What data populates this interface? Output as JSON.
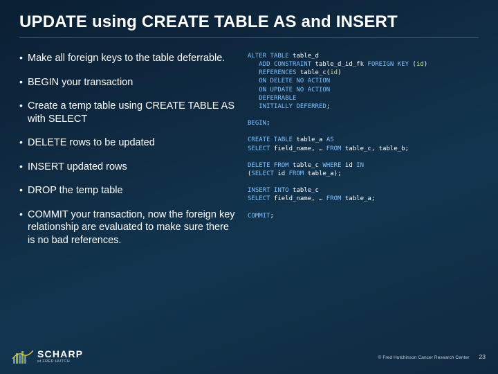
{
  "title": "UPDATE using CREATE TABLE AS and INSERT",
  "bullets": [
    "Make all foreign keys to the table deferrable.",
    "BEGIN your transaction",
    "Create a temp table using CREATE TABLE AS with SELECT",
    "DELETE rows to be updated",
    "INSERT updated rows",
    "DROP the temp table",
    "COMMIT your transaction, now the foreign key relationship are evaluated to make sure there is no bad references."
  ],
  "code": {
    "tokens": [
      {
        "t": "ALTER TABLE",
        "c": "kw"
      },
      {
        "t": " table_d\n   ",
        "c": "id"
      },
      {
        "t": "ADD CONSTRAINT",
        "c": "kw"
      },
      {
        "t": " table_d_id_fk ",
        "c": "id"
      },
      {
        "t": "FOREIGN KEY",
        "c": "kw"
      },
      {
        "t": " (",
        "c": "id"
      },
      {
        "t": "id",
        "c": "pr"
      },
      {
        "t": ")\n   ",
        "c": "id"
      },
      {
        "t": "REFERENCES",
        "c": "kw"
      },
      {
        "t": " table_c(",
        "c": "id"
      },
      {
        "t": "id",
        "c": "pr"
      },
      {
        "t": ")\n   ",
        "c": "id"
      },
      {
        "t": "ON DELETE NO ACTION",
        "c": "kw"
      },
      {
        "t": "\n   ",
        "c": "id"
      },
      {
        "t": "ON UPDATE NO ACTION",
        "c": "kw"
      },
      {
        "t": "\n   ",
        "c": "id"
      },
      {
        "t": "DEFERRABLE",
        "c": "kw"
      },
      {
        "t": "\n   ",
        "c": "id"
      },
      {
        "t": "INITIALLY DEFERRED",
        "c": "kw"
      },
      {
        "t": ";",
        "c": "id"
      },
      {
        "t": "\n\n",
        "c": "id"
      },
      {
        "t": "BEGIN",
        "c": "kw"
      },
      {
        "t": ";",
        "c": "id"
      },
      {
        "t": "\n\n",
        "c": "id"
      },
      {
        "t": "CREATE TABLE",
        "c": "kw"
      },
      {
        "t": " table_a ",
        "c": "id"
      },
      {
        "t": "AS",
        "c": "kw"
      },
      {
        "t": "\n",
        "c": "id"
      },
      {
        "t": "SELECT",
        "c": "kw"
      },
      {
        "t": " field_name, … ",
        "c": "id"
      },
      {
        "t": "FROM",
        "c": "kw"
      },
      {
        "t": " table_c, table_b;",
        "c": "id"
      },
      {
        "t": "\n\n",
        "c": "id"
      },
      {
        "t": "DELETE FROM",
        "c": "kw"
      },
      {
        "t": " table_c ",
        "c": "id"
      },
      {
        "t": "WHERE",
        "c": "kw"
      },
      {
        "t": " id ",
        "c": "id"
      },
      {
        "t": "IN",
        "c": "kw"
      },
      {
        "t": "\n(",
        "c": "id"
      },
      {
        "t": "SELECT",
        "c": "kw"
      },
      {
        "t": " id ",
        "c": "id"
      },
      {
        "t": "FROM",
        "c": "kw"
      },
      {
        "t": " table_a);",
        "c": "id"
      },
      {
        "t": "\n\n",
        "c": "id"
      },
      {
        "t": "INSERT INTO",
        "c": "kw"
      },
      {
        "t": " table_c\n",
        "c": "id"
      },
      {
        "t": "SELECT",
        "c": "kw"
      },
      {
        "t": " field_name, … ",
        "c": "id"
      },
      {
        "t": "FROM",
        "c": "kw"
      },
      {
        "t": " table_a;",
        "c": "id"
      },
      {
        "t": "\n\n",
        "c": "id"
      },
      {
        "t": "COMMIT",
        "c": "kw"
      },
      {
        "t": ";",
        "c": "id"
      }
    ]
  },
  "footer": {
    "brand": "SCHARP",
    "byline": "at FRED HUTCH",
    "copyright": "© Fred Hutchinson Cancer Research Center",
    "page": "23"
  }
}
